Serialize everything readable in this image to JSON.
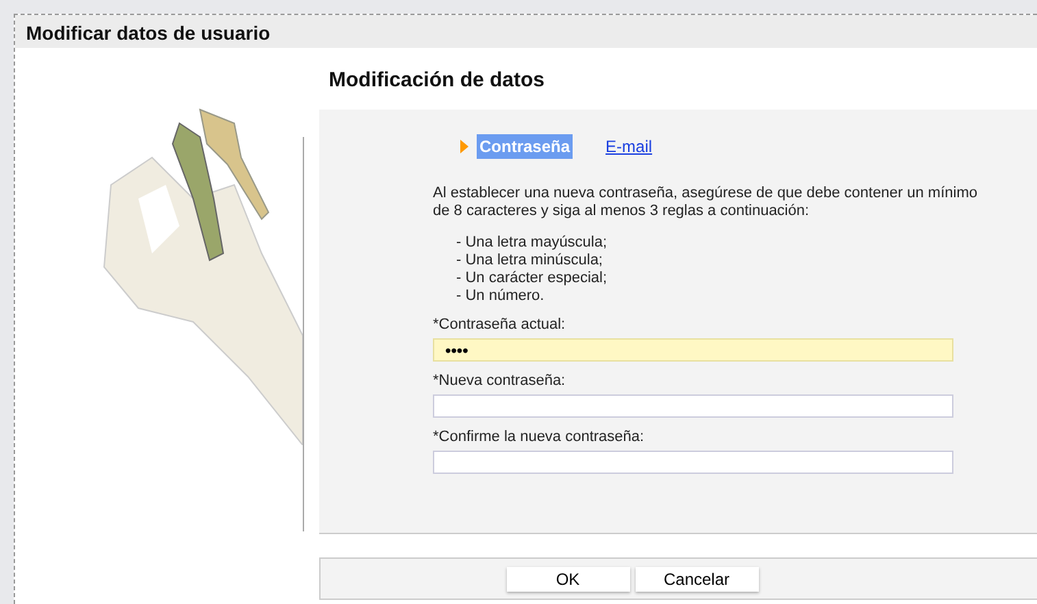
{
  "window": {
    "title": "Modificar datos de usuario"
  },
  "heading": "Modificación de datos",
  "tabs": [
    {
      "label": "Contraseña",
      "selected": true
    },
    {
      "label": "E-mail",
      "selected": false
    }
  ],
  "intro": "Al establecer una nueva contraseña, asegúrese de que debe contener un mínimo de 8 caracteres y siga al menos 3 reglas a continuación:",
  "rules": [
    "- Una letra mayúscula;",
    "- Una letra minúscula;",
    "- Un carácter especial;",
    "- Un número."
  ],
  "fields": [
    {
      "label": "*Contraseña actual:",
      "value": "••••",
      "focused": true
    },
    {
      "label": "*Nueva contraseña:",
      "focused": false
    },
    {
      "label": "*Confirme la nueva contraseña:",
      "focused": false
    }
  ],
  "buttons": [
    "OK",
    "Cancelar"
  ]
}
